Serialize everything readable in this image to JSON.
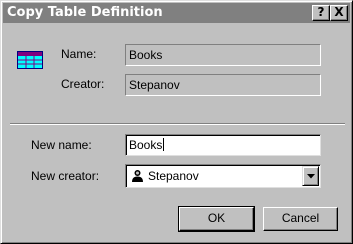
{
  "window": {
    "title": "Copy Table Definition",
    "help_label": "?",
    "close_label": "X"
  },
  "source": {
    "icon": "table-icon",
    "name_label": "Name:",
    "name_value": "Books",
    "creator_label": "Creator:",
    "creator_value": "Stepanov"
  },
  "target": {
    "new_name_label": "New name:",
    "new_name_value": "Books",
    "new_creator_label": "New creator:",
    "new_creator_value": "Stepanov",
    "new_creator_icon": "user-icon"
  },
  "buttons": {
    "ok_label": "OK",
    "cancel_label": "Cancel"
  },
  "colors": {
    "face": "#c0c0c0",
    "titlebar_inactive": "#808080",
    "table_icon_purple": "#800080",
    "table_icon_cyan": "#00ffff"
  }
}
